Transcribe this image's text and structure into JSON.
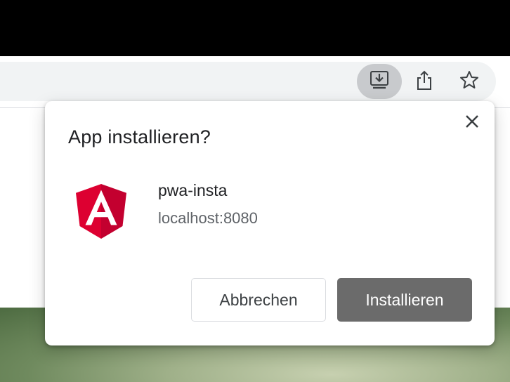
{
  "toolbar": {
    "icons": [
      "install-app-icon",
      "share-icon",
      "bookmark-star-icon"
    ]
  },
  "dialog": {
    "title": "App installieren?",
    "app_name": "pwa-insta",
    "app_origin": "localhost:8080",
    "app_icon": "angular-logo-icon",
    "cancel_label": "Abbrechen",
    "install_label": "Installieren"
  },
  "colors": {
    "install_button_bg": "#6b6b6b",
    "angular_red": "#dd0031",
    "angular_dark_red": "#c3002f",
    "toolbar_active": "#c8cacd"
  }
}
